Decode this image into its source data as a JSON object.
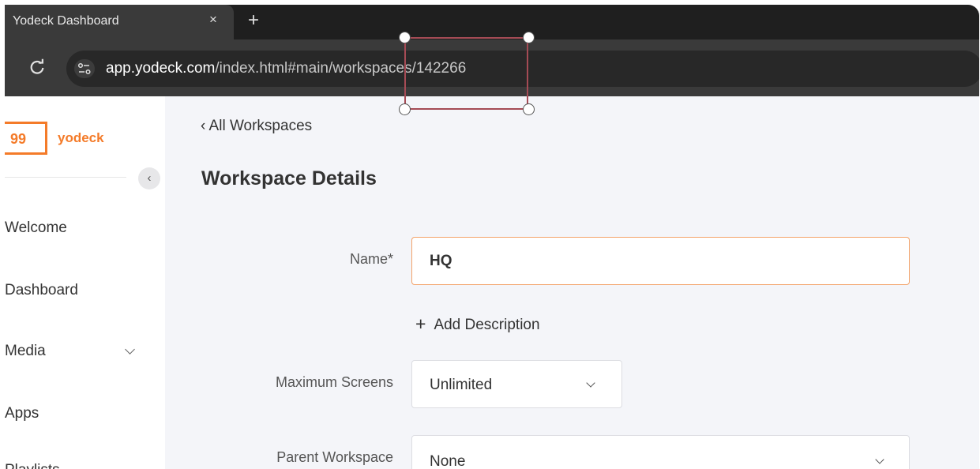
{
  "browser": {
    "tab_title": "Yodeck Dashboard",
    "tab_close": "×",
    "new_tab": "+",
    "url_host": "app.yodeck.com",
    "url_path": "/index.html#main/workspaces/142266"
  },
  "sidebar": {
    "logo_mark": "99",
    "brand": "yodeck",
    "collapse": "‹",
    "items": [
      {
        "label": "Welcome"
      },
      {
        "label": "Dashboard"
      },
      {
        "label": "Media"
      },
      {
        "label": "Apps"
      },
      {
        "label": "Playlists"
      }
    ]
  },
  "main": {
    "back_link": "‹ All Workspaces",
    "title": "Workspace Details",
    "name_label": "Name*",
    "name_value": "HQ",
    "add_description": "Add Description",
    "add_description_icon": "+",
    "max_screens_label": "Maximum Screens",
    "max_screens_value": "Unlimited",
    "parent_label": "Parent Workspace",
    "parent_value": "None"
  },
  "colors": {
    "accent": "#f47b29",
    "input_focus_border": "#f3a36a",
    "selection_box": "#a54b55"
  }
}
